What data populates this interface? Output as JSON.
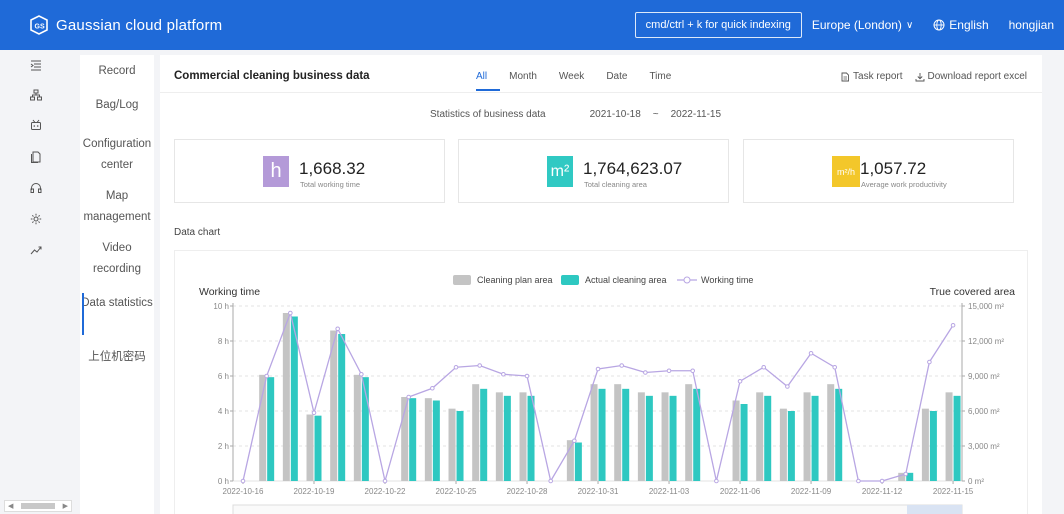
{
  "topbar": {
    "logo_text": "Gaussian cloud platform",
    "quick_index": "cmd/ctrl + k for quick indexing",
    "region": "Europe (London)",
    "language": "English",
    "user": "hongjian"
  },
  "rail": {
    "icons": [
      "menu-collapse-icon",
      "org-chart-icon",
      "robot-icon",
      "document-icon",
      "headset-icon",
      "settings-icon",
      "trend-icon"
    ]
  },
  "subnav": {
    "items": [
      {
        "label": "Record"
      },
      {
        "label": "Bag/Log"
      },
      {
        "label": "Configuration center"
      },
      {
        "label": "Map management"
      },
      {
        "label": "Video recording"
      },
      {
        "label": "Data statistics"
      },
      {
        "label": "上位机密码"
      }
    ]
  },
  "main": {
    "title": "Commercial cleaning business data",
    "tabs": [
      "All",
      "Month",
      "Week",
      "Date",
      "Time"
    ],
    "active_tab": "All",
    "task_report": "Task report",
    "download_report": "Download report excel",
    "stats_label": "Statistics of business data",
    "date_from": "2021-10-18",
    "date_sep": "~",
    "date_to": "2022-11-15",
    "section_label": "Data chart"
  },
  "cards": [
    {
      "icon_text": "h",
      "value": "1,668.32",
      "label": "Total working time",
      "color": "#b49ad8"
    },
    {
      "icon_text": "m²",
      "value": "1,764,623.07",
      "label": "Total cleaning area",
      "color": "#30c9c3"
    },
    {
      "icon_text": "m²/h",
      "value": "1,057.72",
      "label": "Average work productivity",
      "color": "#f3c72a"
    }
  ],
  "colors": {
    "accent": "#1f6ad8",
    "plan_bar": "#c4c4c4",
    "actual_bar": "#2ec8c1",
    "working_line": "#b8a6e3"
  },
  "chart_data": {
    "type": "bar",
    "left_axis_title": "Working time",
    "right_axis_title": "True covered area",
    "legend": [
      "Cleaning plan area",
      "Actual cleaning area",
      "Working time"
    ],
    "left_ticks": [
      "0 h",
      "2 h",
      "4 h",
      "6 h",
      "8 h",
      "10 h"
    ],
    "right_ticks": [
      "0 m²",
      "3,000 m²",
      "6,000 m²",
      "9,000 m²",
      "12,000 m²",
      "15,000 m²"
    ],
    "ylim_left": [
      0,
      10
    ],
    "ylim_right": [
      0,
      15000
    ],
    "x_tick_labels": [
      "2022-10-16",
      "2022-10-19",
      "2022-10-22",
      "2022-10-25",
      "2022-10-28",
      "2022-10-31",
      "2022-11-03",
      "2022-11-06",
      "2022-11-09",
      "2022-11-12",
      "2022-11-15"
    ],
    "x_tick_every": 3,
    "categories": [
      "10-16",
      "10-17",
      "10-18",
      "10-19",
      "10-20",
      "10-21",
      "10-22",
      "10-23",
      "10-24",
      "10-25",
      "10-26",
      "10-27",
      "10-28",
      "10-29",
      "10-30",
      "10-31",
      "11-01",
      "11-02",
      "11-03",
      "11-04",
      "11-05",
      "11-06",
      "11-07",
      "11-08",
      "11-09",
      "11-10",
      "11-11",
      "11-12",
      "11-13",
      "11-14",
      "11-15"
    ],
    "series": [
      {
        "name": "Cleaning plan area",
        "axis": "right",
        "values": [
          0,
          9100,
          14400,
          5700,
          12900,
          9100,
          0,
          7200,
          7100,
          6200,
          8300,
          7600,
          7600,
          0,
          3500,
          8300,
          8300,
          7600,
          7600,
          8300,
          0,
          6900,
          7600,
          6200,
          7600,
          8300,
          0,
          0,
          700,
          6200,
          7600
        ]
      },
      {
        "name": "Actual cleaning area",
        "axis": "right",
        "values": [
          0,
          8900,
          14100,
          5600,
          12600,
          8900,
          0,
          7100,
          6900,
          6000,
          7900,
          7300,
          7300,
          0,
          3300,
          7900,
          7900,
          7300,
          7300,
          7900,
          0,
          6600,
          7300,
          6000,
          7300,
          7900,
          0,
          0,
          700,
          6000,
          7300
        ]
      },
      {
        "name": "Working time",
        "axis": "left",
        "values": [
          0,
          6.0,
          9.6,
          3.9,
          8.7,
          6.1,
          0,
          4.8,
          5.3,
          6.5,
          6.6,
          6.1,
          6.0,
          0,
          2.3,
          6.4,
          6.6,
          6.2,
          6.3,
          6.3,
          0,
          5.7,
          6.5,
          5.4,
          7.3,
          6.5,
          0,
          0,
          0.4,
          6.8,
          8.9
        ]
      }
    ]
  }
}
